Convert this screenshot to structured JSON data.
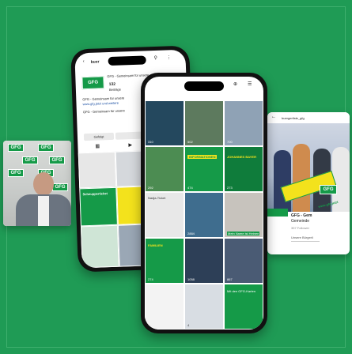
{
  "profile": {
    "search_text": "buer",
    "name": "GFG - Gemeinsam für unsere",
    "posts_count": "132",
    "posts_label": "Beiträge",
    "bio_line1": "GFG - Gemeinsam für unsere",
    "bio_line2": "www.gfg.jetzt und weitere",
    "bio_line3": "GFG - Gemeinsam für unsere",
    "follow_label": "Gefolgt"
  },
  "reel_counts": [
    "310",
    "502",
    "700",
    "292",
    "474",
    "273",
    "4"
  ],
  "tile_captions": [
    "INFORMATIONEN",
    "JOHANNES BAYER",
    "Nadja-Ticket",
    "FAMILIEN",
    "Mein Name ist Heinen",
    "Schnupperticket",
    "Mit den GFG-Karten"
  ],
  "logo_text": "GFG",
  "right_card": {
    "profile_handle": "buergerliste_gfg",
    "banner_text": "www.gfg.jetzt",
    "title": "GFG - Gem",
    "subtitle": "Gemeinde",
    "followers": "357 Follower",
    "bio": "Unsere Bürgerli"
  },
  "back_card": {
    "reel_counts": [
      "2884",
      "867",
      "274",
      "1058"
    ]
  },
  "colors": {
    "background": "#1f9b55",
    "brand_green": "#159a48",
    "accent_yellow": "#f3e21c"
  }
}
